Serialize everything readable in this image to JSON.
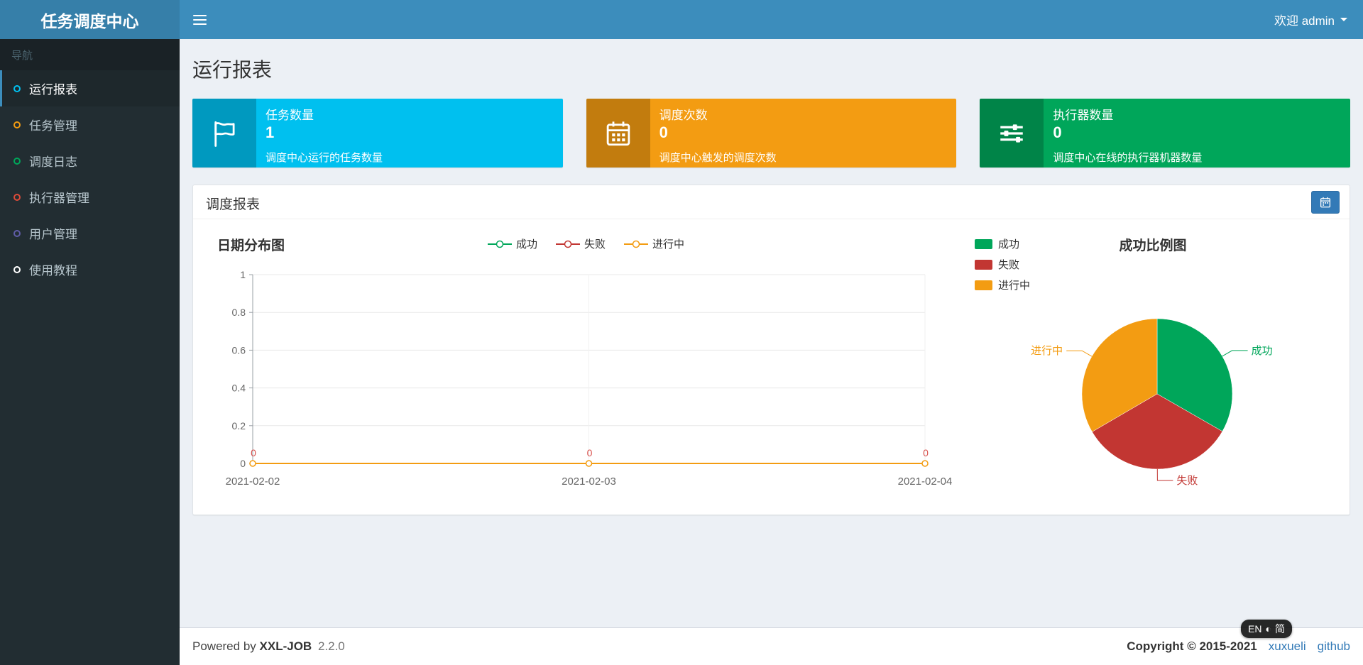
{
  "header": {
    "logo": "任务调度中心",
    "welcome": "欢迎 admin"
  },
  "sidebar": {
    "section_label": "导航",
    "items": [
      {
        "label": "运行报表",
        "color": "#00c0ef",
        "active": true
      },
      {
        "label": "任务管理",
        "color": "#f39c12",
        "active": false
      },
      {
        "label": "调度日志",
        "color": "#00a65a",
        "active": false
      },
      {
        "label": "执行器管理",
        "color": "#dd4b39",
        "active": false
      },
      {
        "label": "用户管理",
        "color": "#605ca8",
        "active": false
      },
      {
        "label": "使用教程",
        "color": "#ffffff",
        "active": false
      }
    ]
  },
  "page": {
    "title": "运行报表"
  },
  "stat_boxes": [
    {
      "label": "任务数量",
      "value": "1",
      "description": "调度中心运行的任务数量",
      "color": "#00c0ef",
      "icon": "flag-icon"
    },
    {
      "label": "调度次数",
      "value": "0",
      "description": "调度中心触发的调度次数",
      "color": "#f39c12",
      "icon": "calendar-icon"
    },
    {
      "label": "执行器数量",
      "value": "0",
      "description": "调度中心在线的执行器机器数量",
      "color": "#00a65a",
      "icon": "sliders-icon"
    }
  ],
  "panel": {
    "title": "调度报表"
  },
  "chart_data": [
    {
      "type": "line",
      "title": "日期分布图",
      "x": [
        "2021-02-02",
        "2021-02-03",
        "2021-02-04"
      ],
      "series": [
        {
          "name": "成功",
          "color": "#00a65a",
          "values": [
            0,
            0,
            0
          ]
        },
        {
          "name": "失败",
          "color": "#c23632",
          "values": [
            0,
            0,
            0
          ]
        },
        {
          "name": "进行中",
          "color": "#f39c12",
          "values": [
            0,
            0,
            0
          ]
        }
      ],
      "ylim": [
        0,
        1
      ],
      "yticks": [
        0,
        0.2,
        0.4,
        0.6,
        0.8,
        1
      ],
      "point_labels": [
        "0",
        "0",
        "0"
      ],
      "point_label_color": "#d9534f",
      "legend_position": "top",
      "grid": true
    },
    {
      "type": "pie",
      "title": "成功比例图",
      "slices": [
        {
          "name": "成功",
          "value": 33.3,
          "color": "#00a65a"
        },
        {
          "name": "失败",
          "value": 33.3,
          "color": "#c23632"
        },
        {
          "name": "进行中",
          "value": 33.4,
          "color": "#f39c12"
        }
      ],
      "legend_position": "top-left"
    }
  ],
  "footer": {
    "powered_prefix": "Powered by",
    "product": "XXL-JOB",
    "version": "2.2.0",
    "copyright": "Copyright © 2015-2021",
    "links": [
      {
        "label": "xuxueli"
      },
      {
        "label": "github"
      }
    ]
  },
  "ime": {
    "left": "EN",
    "icon": "◐",
    "right": "简"
  }
}
